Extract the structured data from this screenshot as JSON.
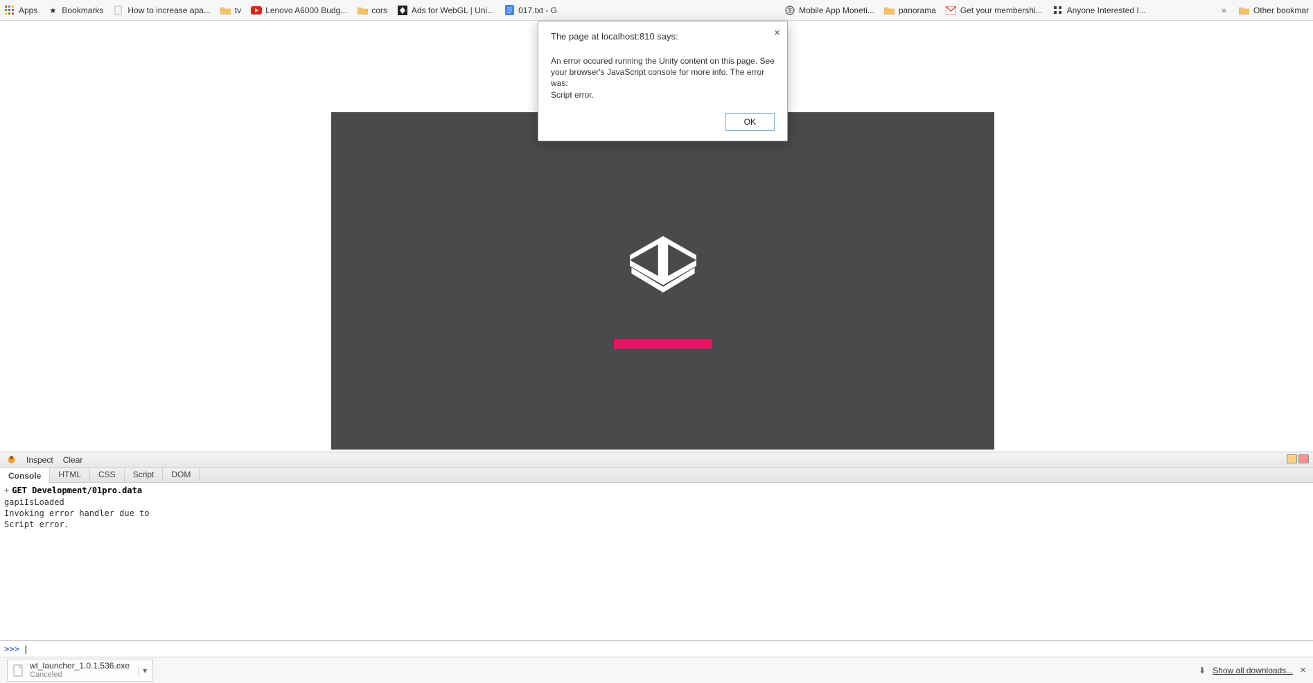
{
  "bookmarks": {
    "items": [
      {
        "label": "Apps"
      },
      {
        "label": "Bookmarks"
      },
      {
        "label": "How to increase apa..."
      },
      {
        "label": "tv"
      },
      {
        "label": "Lenovo A6000 Budg..."
      },
      {
        "label": "cors"
      },
      {
        "label": "Ads for WebGL | Uni..."
      },
      {
        "label": "017.txt - G"
      },
      {
        "label": "Mobile App Moneti..."
      },
      {
        "label": "panorama"
      },
      {
        "label": "Get your membershi..."
      },
      {
        "label": "Anyone Interested I..."
      }
    ],
    "overflow_label": "»",
    "other_label": "Other bookmar"
  },
  "alert": {
    "title": "The page at localhost:810 says:",
    "body_line1": "An error occured running the Unity content on this page.",
    "body_line2": "See your browser's JavaScript console for more info. The error was:",
    "body_line3": "Script error.",
    "ok_label": "OK"
  },
  "devtools": {
    "toolbar": {
      "inspect": "Inspect",
      "clear": "Clear"
    },
    "tabs": [
      "Console",
      "HTML",
      "CSS",
      "Script",
      "DOM"
    ],
    "console": {
      "request": "GET Development/01pro.data",
      "lines": [
        "gapiIsLoaded",
        "Invoking error handler due to",
        "Script error."
      ]
    },
    "prompt": ">>>"
  },
  "downloads": {
    "item": {
      "filename": "wt_launcher_1.0.1.536.exe",
      "status": "Canceled"
    },
    "show_all": "Show all downloads..."
  }
}
